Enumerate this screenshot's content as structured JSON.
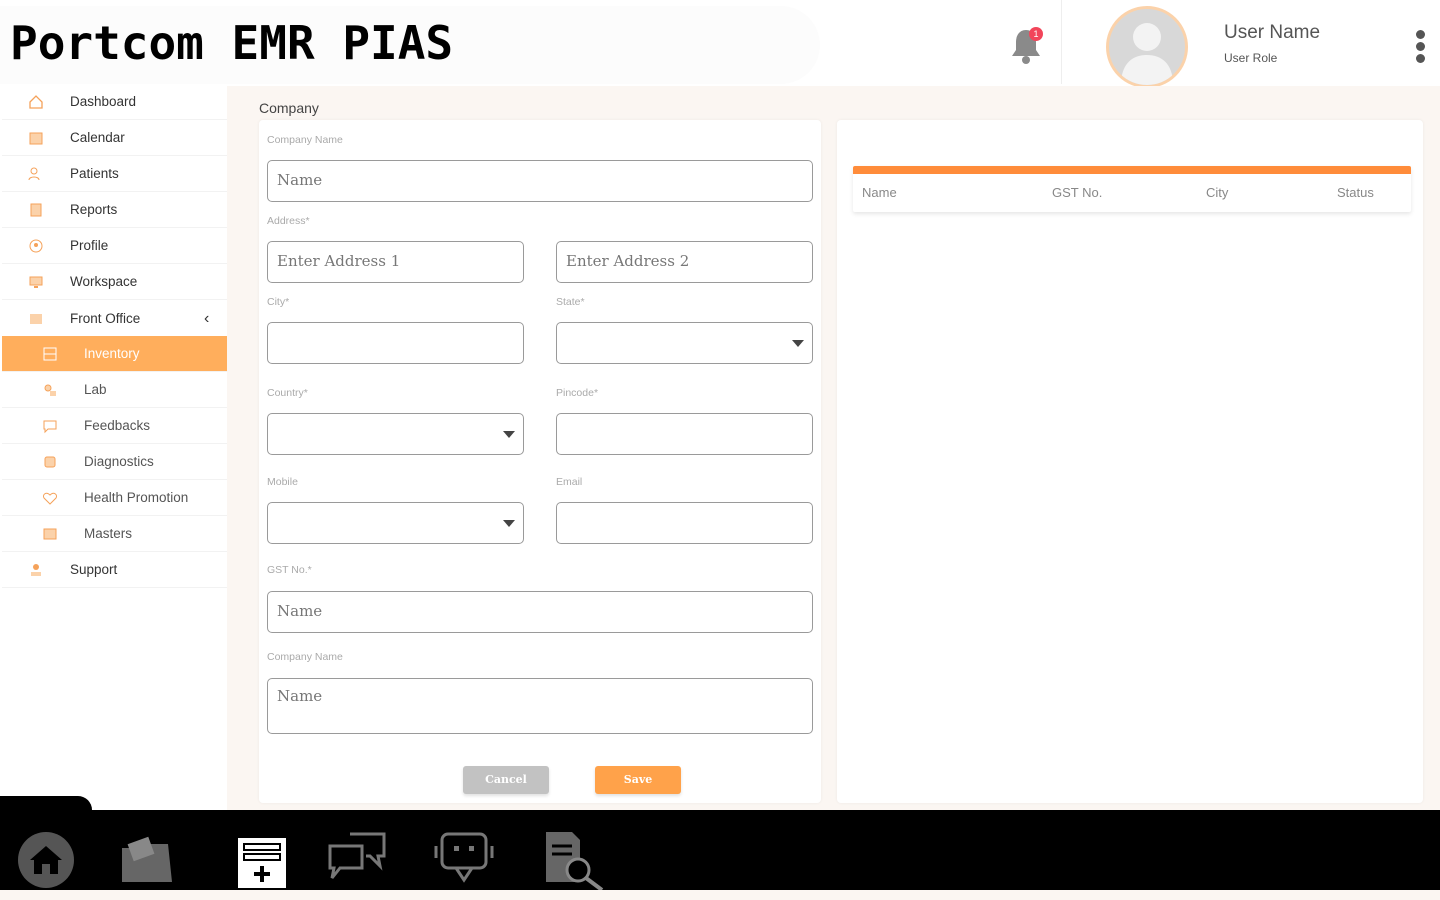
{
  "app": {
    "title": "Portcom EMR PIAS"
  },
  "header": {
    "notification_count": "1",
    "user_name": "User Name",
    "user_role": "User Role"
  },
  "colors": {
    "accent": "#ffae5c",
    "accent_dark": "#ff8c3a",
    "badge": "#f2455a"
  },
  "sidebar": {
    "items": [
      {
        "label": "Dashboard",
        "icon": "home-icon"
      },
      {
        "label": "Calendar",
        "icon": "calendar-icon"
      },
      {
        "label": "Patients",
        "icon": "patients-icon"
      },
      {
        "label": "Reports",
        "icon": "reports-icon"
      },
      {
        "label": "Profile",
        "icon": "profile-icon"
      },
      {
        "label": "Workspace",
        "icon": "monitor-icon"
      },
      {
        "label": "Front Office",
        "icon": "front-office-icon",
        "expanded": true
      },
      {
        "label": "Inventory",
        "icon": "inventory-icon",
        "active": true
      },
      {
        "label": "Lab",
        "icon": "lab-icon"
      },
      {
        "label": "Feedbacks",
        "icon": "feedback-icon"
      },
      {
        "label": "Diagnostics",
        "icon": "diagnostics-icon"
      },
      {
        "label": "Health Promotion",
        "icon": "health-icon"
      },
      {
        "label": "Masters",
        "icon": "masters-icon"
      },
      {
        "label": "Support",
        "icon": "support-icon"
      }
    ]
  },
  "form": {
    "section_title": "Company",
    "company_name_label": "Company Name",
    "company_name_placeholder": "Name",
    "address_label": "Address*",
    "address1_placeholder": "Enter Address 1",
    "address2_placeholder": "Enter Address 2",
    "city_label": "City*",
    "state_label": "State*",
    "country_label": "Country*",
    "pincode_label": "Pincode*",
    "mobile_label": "Mobile",
    "email_label": "Email",
    "gst_label": "GST No.*",
    "gst_placeholder": "Name",
    "company_name2_label": "Company Name",
    "company_name2_placeholder": "Name",
    "cancel_label": "Cancel",
    "save_label": "Save"
  },
  "table": {
    "columns": [
      "Name",
      "GST No.",
      "City",
      "Status"
    ]
  },
  "dock": {
    "items": [
      "home-icon",
      "folder-icon",
      "medical-record-icon",
      "chat-icon",
      "bot-icon",
      "document-search-icon"
    ]
  }
}
